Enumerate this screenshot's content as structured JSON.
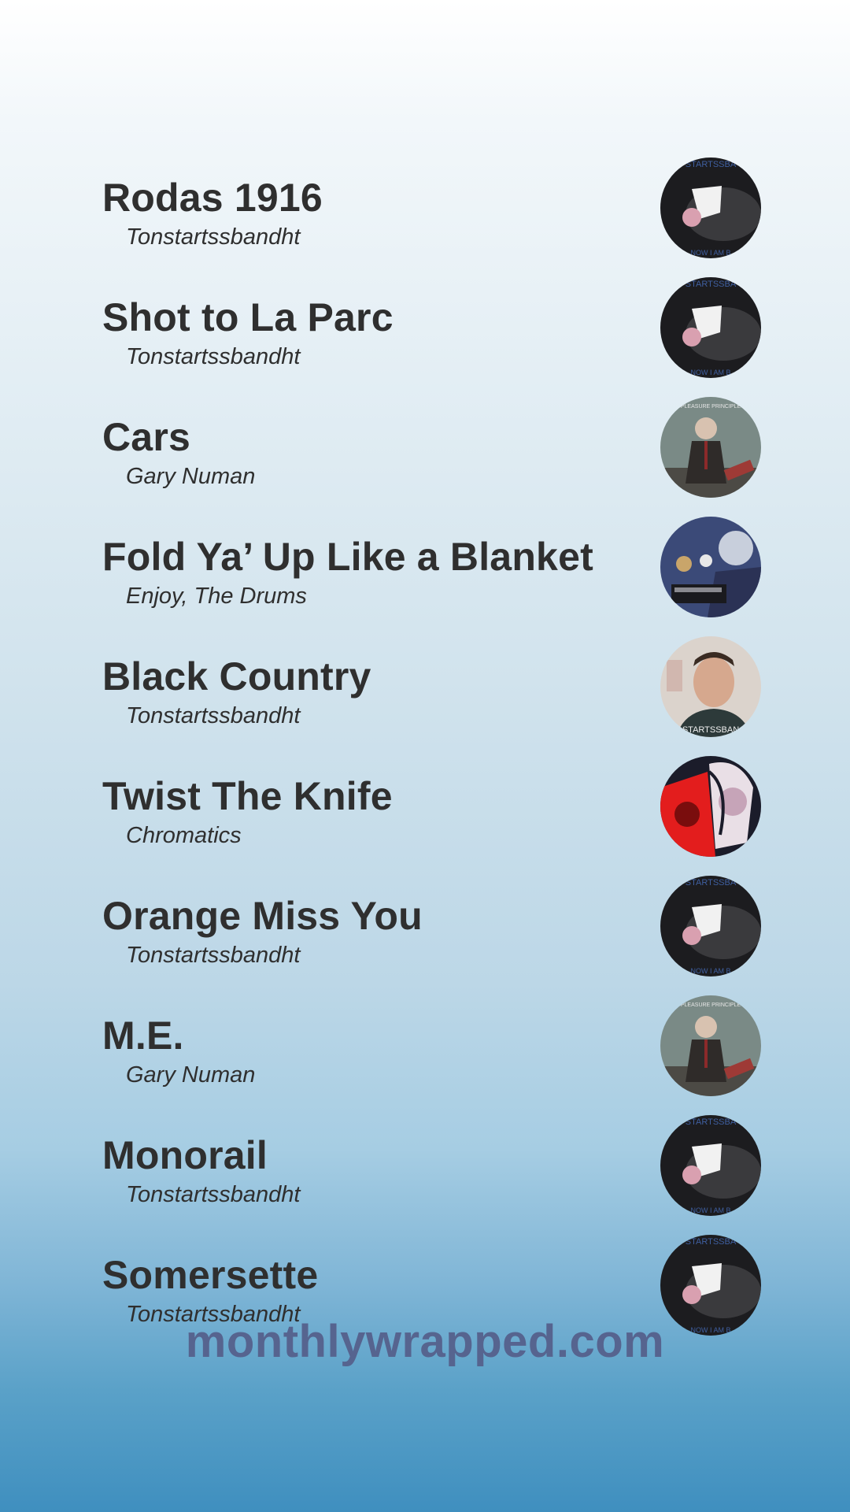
{
  "tracks": [
    {
      "title": "Rodas 1916",
      "artist": "Tonstartssbandht",
      "cover_icon": "album-cover-tonstartssbandht-icon"
    },
    {
      "title": "Shot to La Parc",
      "artist": "Tonstartssbandht",
      "cover_icon": "album-cover-tonstartssbandht-icon"
    },
    {
      "title": "Cars",
      "artist": "Gary Numan",
      "cover_icon": "album-cover-gary-numan-icon"
    },
    {
      "title": "Fold Ya’ Up Like a Blanket",
      "artist": "Enjoy, The Drums",
      "cover_icon": "album-cover-enjoy-the-drums-icon"
    },
    {
      "title": "Black Country",
      "artist": "Tonstartssbandht",
      "cover_icon": "album-cover-portrait-icon"
    },
    {
      "title": "Twist The Knife",
      "artist": "Chromatics",
      "cover_icon": "album-cover-chromatics-icon"
    },
    {
      "title": "Orange Miss You",
      "artist": "Tonstartssbandht",
      "cover_icon": "album-cover-tonstartssbandht-icon"
    },
    {
      "title": "M.E.",
      "artist": "Gary Numan",
      "cover_icon": "album-cover-gary-numan-icon"
    },
    {
      "title": "Monorail",
      "artist": "Tonstartssbandht",
      "cover_icon": "album-cover-tonstartssbandht-icon"
    },
    {
      "title": "Somersette",
      "artist": "Tonstartssbandht",
      "cover_icon": "album-cover-tonstartssbandht-icon"
    }
  ],
  "cover_text": {
    "tonstartssbandht_top": "STARTSSBA",
    "tonstartssbandht_bottom": "NOW I AM B",
    "gary_numan_top": "PLEASURE PRINCIPLE",
    "portrait_bottom": "STARTSSBAN"
  },
  "footer": {
    "link": "monthlywrapped.com"
  },
  "colors": {
    "title_text": "#2f2f2f",
    "footer_text": "#56648f",
    "gradient_top": "#ffffff",
    "gradient_bottom": "#3f8fbf"
  }
}
